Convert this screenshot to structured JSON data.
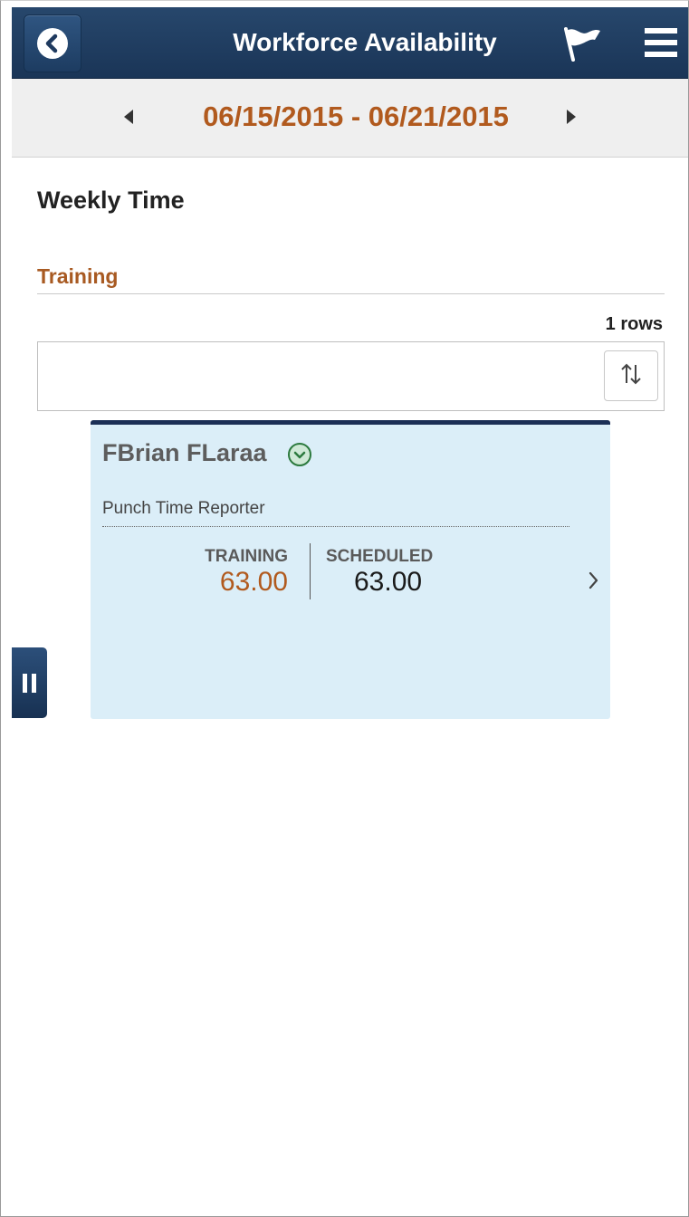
{
  "header": {
    "title": "Workforce Availability",
    "back_icon": "back-icon",
    "flag_icon": "flag-icon",
    "menu_icon": "hamburger-menu-icon"
  },
  "date_nav": {
    "range": "06/15/2015 - 06/21/2015",
    "prev_icon": "caret-left-icon",
    "next_icon": "caret-right-icon"
  },
  "page": {
    "heading": "Weekly Time",
    "section_title": "Training",
    "rows_count": "1 rows",
    "sort_icon": "sort-icon"
  },
  "card": {
    "name": "FBrian FLaraa",
    "role": "Punch Time Reporter",
    "training_label": "TRAINING",
    "training_value": "63.00",
    "scheduled_label": "SCHEDULED",
    "scheduled_value": "63.00"
  },
  "colors": {
    "header_bg": "#1f3a5f",
    "accent_orange": "#b15a1e",
    "card_bg": "#dbeef8",
    "card_top_border": "#1b2f56"
  }
}
